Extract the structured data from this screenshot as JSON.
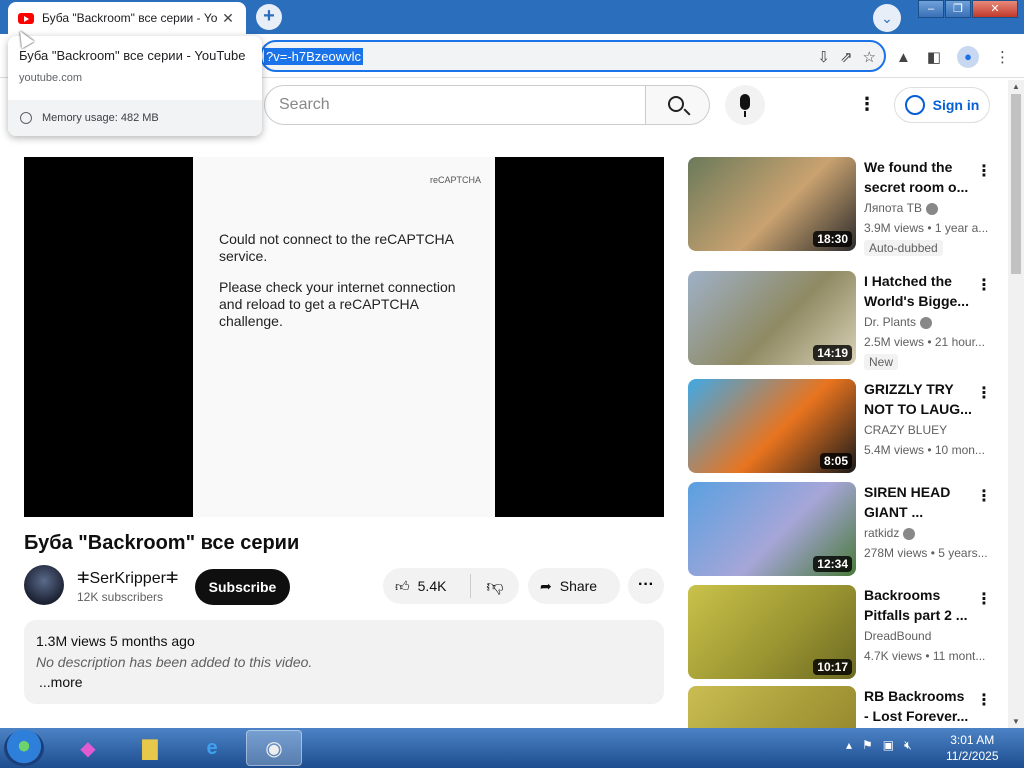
{
  "browser": {
    "tab_title": "Буба \"Backroom\" все серии - Yo",
    "tab_close": "✕",
    "new_tab": "+",
    "url_selected": "?v=-h7Bzeowvlc",
    "hover_card": {
      "title": "Буба \"Backroom\" все серии - YouTube",
      "domain": "youtube.com",
      "memory": "Memory usage: 482 MB"
    }
  },
  "youtube": {
    "search_placeholder": "Search",
    "sign_in": "Sign in",
    "captcha": {
      "logo": "reCAPTCHA",
      "message1": "Could not connect to the reCAPTCHA service.",
      "message2": "Please check your internet connection and reload to get a reCAPTCHA challenge."
    },
    "video": {
      "title": "Буба \"Backroom\" все серии",
      "channel": "ⵐSerKripperⵐ",
      "subscribers": "12K subscribers",
      "subscribe_label": "Subscribe",
      "likes": "5.4K",
      "share_label": "Share",
      "meta": "1.3M views  5 months ago",
      "description": "No description has been added to this video.",
      "more_label": "...more"
    },
    "recommendations": [
      {
        "title": "We found the secret room o...",
        "channel": "Ляпота ТВ",
        "verified": true,
        "stats": "3.9M views • 1 year a...",
        "duration": "18:30",
        "badge": "Auto-dubbed",
        "colors": [
          "#6a7a5a",
          "#c9a270",
          "#2b2b2b"
        ]
      },
      {
        "title": "I Hatched the World's Bigge...",
        "channel": "Dr. Plants",
        "verified": true,
        "stats": "2.5M views • 21 hour...",
        "duration": "14:19",
        "badge": "New",
        "colors": [
          "#9fb1c8",
          "#8f8a62",
          "#d9d2b8"
        ]
      },
      {
        "title": "GRIZZLY TRY NOT TO LAUG...",
        "channel": "CRAZY BLUEY",
        "verified": false,
        "stats": "5.4M views • 10 mon...",
        "duration": "8:05",
        "badge": "",
        "colors": [
          "#3fa9e6",
          "#e8741f",
          "#1a1a1a"
        ]
      },
      {
        "title": "SIREN HEAD GIANT ...",
        "channel": "ratkidz",
        "verified": true,
        "stats": "278M views • 5 years...",
        "duration": "12:34",
        "badge": "",
        "colors": [
          "#5aa0e0",
          "#a6a6d8",
          "#4a7a3a"
        ]
      },
      {
        "title": "Backrooms Pitfalls part 2 ...",
        "channel": "DreadBound",
        "verified": false,
        "stats": "4.7K views • 11 mont...",
        "duration": "10:17",
        "badge": "",
        "colors": [
          "#c9c24a",
          "#9c9632",
          "#6c6a22"
        ]
      },
      {
        "title": "RB Backrooms - Lost Forever...",
        "channel": "",
        "verified": false,
        "stats": "",
        "duration": "",
        "badge": "",
        "colors": [
          "#c9bd52",
          "#a69a38",
          "#8a7e2a"
        ]
      }
    ]
  },
  "taskbar": {
    "time": "3:01 AM",
    "date": "11/2/2025"
  }
}
